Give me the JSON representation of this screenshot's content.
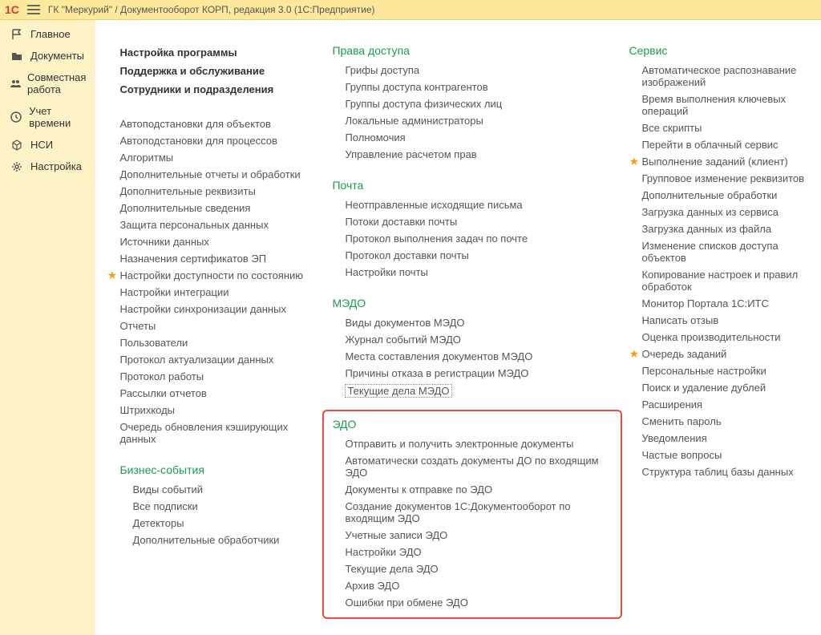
{
  "header": {
    "logo": "1С",
    "title": "ГК \"Меркурий\" / Документооборот КОРП, редакция 3.0  (1С:Предприятие)"
  },
  "sidebar": {
    "items": [
      {
        "label": "Главное",
        "icon": "flag"
      },
      {
        "label": "Документы",
        "icon": "folder"
      },
      {
        "label": "Совместная работа",
        "icon": "people"
      },
      {
        "label": "Учет времени",
        "icon": "clock"
      },
      {
        "label": "НСИ",
        "icon": "cube"
      },
      {
        "label": "Настройка",
        "icon": "gear"
      }
    ]
  },
  "col1": {
    "top": [
      "Настройка программы",
      "Поддержка и обслуживание",
      "Сотрудники и подразделения"
    ],
    "main": [
      {
        "t": "Автоподстановки для объектов"
      },
      {
        "t": "Автоподстановки для процессов"
      },
      {
        "t": "Алгоритмы"
      },
      {
        "t": "Дополнительные отчеты и обработки"
      },
      {
        "t": "Дополнительные реквизиты"
      },
      {
        "t": "Дополнительные сведения"
      },
      {
        "t": "Защита персональных данных"
      },
      {
        "t": "Источники данных"
      },
      {
        "t": "Назначения сертификатов ЭП"
      },
      {
        "t": "Настройки доступности по состоянию",
        "star": true
      },
      {
        "t": "Настройки интеграции"
      },
      {
        "t": "Настройки синхронизации данных"
      },
      {
        "t": "Отчеты"
      },
      {
        "t": "Пользователи"
      },
      {
        "t": "Протокол актуализации данных"
      },
      {
        "t": "Протокол работы"
      },
      {
        "t": "Рассылки отчетов"
      },
      {
        "t": "Штрихкоды"
      },
      {
        "t": "Очередь обновления кэширующих данных"
      }
    ],
    "biz_title": "Бизнес-события",
    "biz": [
      "Виды событий",
      "Все подписки",
      "Детекторы",
      "Дополнительные обработчики"
    ]
  },
  "col2": {
    "s1_title": "Права доступа",
    "s1": [
      "Грифы доступа",
      "Группы доступа контрагентов",
      "Группы доступа физических лиц",
      "Локальные администраторы",
      "Полномочия",
      "Управление расчетом прав"
    ],
    "s2_title": "Почта",
    "s2": [
      "Неотправленные исходящие письма",
      "Потоки доставки почты",
      "Протокол выполнения задач по почте",
      "Протокол доставки почты",
      "Настройки почты"
    ],
    "s3_title": "МЭДО",
    "s3": [
      "Виды документов МЭДО",
      "Журнал событий МЭДО",
      "Места составления документов МЭДО",
      "Причины отказа в регистрации МЭДО"
    ],
    "s3_last": "Текущие дела МЭДО",
    "s4_title": "ЭДО",
    "s4": [
      "Отправить и получить электронные документы",
      "Автоматически создать документы ДО по входящим ЭДО",
      "Документы к отправке по ЭДО",
      "Создание документов 1С:Документооборот по входящим ЭДО",
      "Учетные записи ЭДО",
      "Настройки ЭДО",
      "Текущие дела ЭДО",
      "Архив ЭДО",
      "Ошибки при обмене ЭДО"
    ]
  },
  "col3": {
    "title": "Сервис",
    "items": [
      {
        "t": "Автоматическое распознавание изображений"
      },
      {
        "t": "Время выполнения ключевых операций"
      },
      {
        "t": "Все скрипты"
      },
      {
        "t": "Перейти в облачный сервис"
      },
      {
        "t": "Выполнение заданий (клиент)",
        "star": true
      },
      {
        "t": "Групповое изменение реквизитов"
      },
      {
        "t": "Дополнительные обработки"
      },
      {
        "t": "Загрузка данных из сервиса"
      },
      {
        "t": "Загрузка данных из файла"
      },
      {
        "t": "Изменение списков доступа объектов"
      },
      {
        "t": "Копирование настроек и правил обработок"
      },
      {
        "t": "Монитор Портала 1С:ИТС"
      },
      {
        "t": "Написать отзыв"
      },
      {
        "t": "Оценка производительности"
      },
      {
        "t": "Очередь заданий",
        "star": true
      },
      {
        "t": "Персональные настройки"
      },
      {
        "t": "Поиск и удаление дублей"
      },
      {
        "t": "Расширения"
      },
      {
        "t": "Сменить пароль"
      },
      {
        "t": "Уведомления"
      },
      {
        "t": "Частые вопросы"
      },
      {
        "t": "Структура таблиц базы данных"
      }
    ]
  }
}
